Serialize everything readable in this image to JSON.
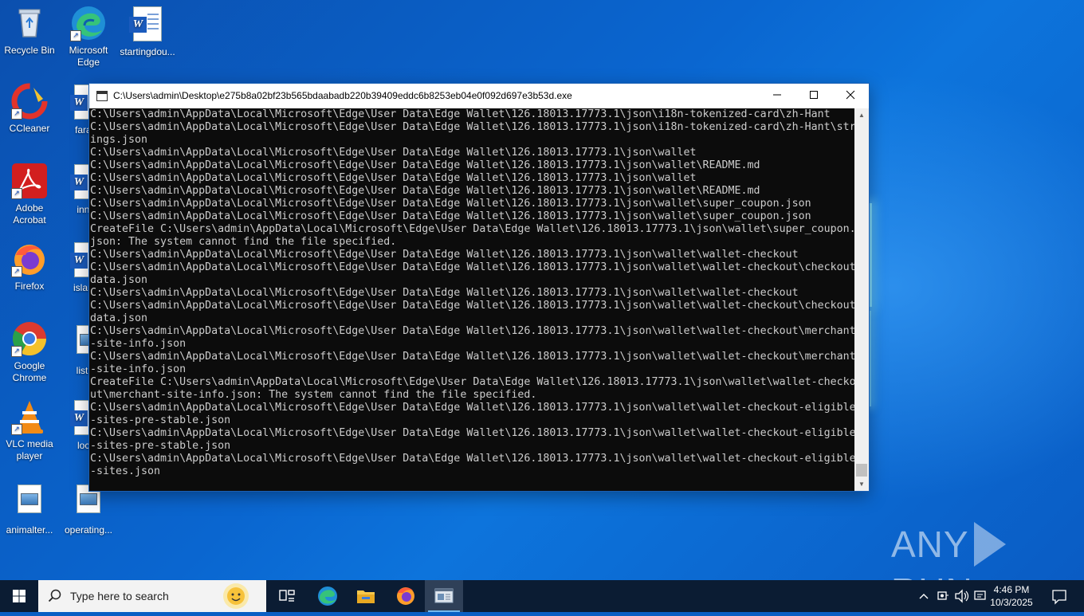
{
  "desktop_icons": [
    {
      "label": "Recycle Bin",
      "icon": "recycle-bin-icon"
    },
    {
      "label": "Microsoft Edge",
      "icon": "edge-icon"
    },
    {
      "label": "startingdou...",
      "icon": "word-document-icon"
    },
    {
      "label": "CCleaner",
      "icon": "ccleaner-icon"
    },
    {
      "label": "farage",
      "icon": "word-document-icon"
    },
    {
      "label": "Adobe Acrobat",
      "icon": "acrobat-icon"
    },
    {
      "label": "innqu",
      "icon": "word-document-icon"
    },
    {
      "label": "Firefox",
      "icon": "firefox-icon"
    },
    {
      "label": "islandp",
      "icon": "word-document-icon"
    },
    {
      "label": "Google Chrome",
      "icon": "chrome-icon"
    },
    {
      "label": "listing",
      "icon": "image-file-icon"
    },
    {
      "label": "VLC media player",
      "icon": "vlc-icon"
    },
    {
      "label": "locati",
      "icon": "word-document-icon"
    },
    {
      "label": "animalter...",
      "icon": "image-file-icon"
    },
    {
      "label": "operating...",
      "icon": "image-file-icon"
    }
  ],
  "console": {
    "title": "C:\\Users\\admin\\Desktop\\e275b8a02bf23b565bdaabadb220b39409eddc6b8253eb04e0f092d697e3b53d.exe",
    "lines": [
      "C:\\Users\\admin\\AppData\\Local\\Microsoft\\Edge\\User Data\\Edge Wallet\\126.18013.17773.1\\json\\i18n-tokenized-card\\zh-Hant",
      "C:\\Users\\admin\\AppData\\Local\\Microsoft\\Edge\\User Data\\Edge Wallet\\126.18013.17773.1\\json\\i18n-tokenized-card\\zh-Hant\\str",
      "ings.json",
      "C:\\Users\\admin\\AppData\\Local\\Microsoft\\Edge\\User Data\\Edge Wallet\\126.18013.17773.1\\json\\wallet",
      "C:\\Users\\admin\\AppData\\Local\\Microsoft\\Edge\\User Data\\Edge Wallet\\126.18013.17773.1\\json\\wallet\\README.md",
      "C:\\Users\\admin\\AppData\\Local\\Microsoft\\Edge\\User Data\\Edge Wallet\\126.18013.17773.1\\json\\wallet",
      "C:\\Users\\admin\\AppData\\Local\\Microsoft\\Edge\\User Data\\Edge Wallet\\126.18013.17773.1\\json\\wallet\\README.md",
      "C:\\Users\\admin\\AppData\\Local\\Microsoft\\Edge\\User Data\\Edge Wallet\\126.18013.17773.1\\json\\wallet\\super_coupon.json",
      "C:\\Users\\admin\\AppData\\Local\\Microsoft\\Edge\\User Data\\Edge Wallet\\126.18013.17773.1\\json\\wallet\\super_coupon.json",
      "CreateFile C:\\Users\\admin\\AppData\\Local\\Microsoft\\Edge\\User Data\\Edge Wallet\\126.18013.17773.1\\json\\wallet\\super_coupon.",
      "json: The system cannot find the file specified.",
      "C:\\Users\\admin\\AppData\\Local\\Microsoft\\Edge\\User Data\\Edge Wallet\\126.18013.17773.1\\json\\wallet\\wallet-checkout",
      "C:\\Users\\admin\\AppData\\Local\\Microsoft\\Edge\\User Data\\Edge Wallet\\126.18013.17773.1\\json\\wallet\\wallet-checkout\\checkout",
      "data.json",
      "C:\\Users\\admin\\AppData\\Local\\Microsoft\\Edge\\User Data\\Edge Wallet\\126.18013.17773.1\\json\\wallet\\wallet-checkout",
      "C:\\Users\\admin\\AppData\\Local\\Microsoft\\Edge\\User Data\\Edge Wallet\\126.18013.17773.1\\json\\wallet\\wallet-checkout\\checkout",
      "data.json",
      "C:\\Users\\admin\\AppData\\Local\\Microsoft\\Edge\\User Data\\Edge Wallet\\126.18013.17773.1\\json\\wallet\\wallet-checkout\\merchant",
      "-site-info.json",
      "C:\\Users\\admin\\AppData\\Local\\Microsoft\\Edge\\User Data\\Edge Wallet\\126.18013.17773.1\\json\\wallet\\wallet-checkout\\merchant",
      "-site-info.json",
      "CreateFile C:\\Users\\admin\\AppData\\Local\\Microsoft\\Edge\\User Data\\Edge Wallet\\126.18013.17773.1\\json\\wallet\\wallet-checko",
      "ut\\merchant-site-info.json: The system cannot find the file specified.",
      "C:\\Users\\admin\\AppData\\Local\\Microsoft\\Edge\\User Data\\Edge Wallet\\126.18013.17773.1\\json\\wallet\\wallet-checkout-eligible",
      "-sites-pre-stable.json",
      "C:\\Users\\admin\\AppData\\Local\\Microsoft\\Edge\\User Data\\Edge Wallet\\126.18013.17773.1\\json\\wallet\\wallet-checkout-eligible",
      "-sites-pre-stable.json",
      "C:\\Users\\admin\\AppData\\Local\\Microsoft\\Edge\\User Data\\Edge Wallet\\126.18013.17773.1\\json\\wallet\\wallet-checkout-eligible",
      "-sites.json"
    ]
  },
  "watermark": {
    "left": "ANY",
    "right": "RUN"
  },
  "taskbar": {
    "search_placeholder": "Type here to search",
    "apps": [
      "task-view-icon",
      "edge-icon",
      "file-explorer-icon",
      "firefox-icon",
      "console-app-icon"
    ],
    "clock_time": "4:46 PM",
    "clock_date": "10/3/2025"
  },
  "colors": {
    "console_bg": "#0c0c0c",
    "console_text": "#cccccc",
    "taskbar_bg": "#0b1c33",
    "desktop_bg": "#0a5fc4"
  }
}
